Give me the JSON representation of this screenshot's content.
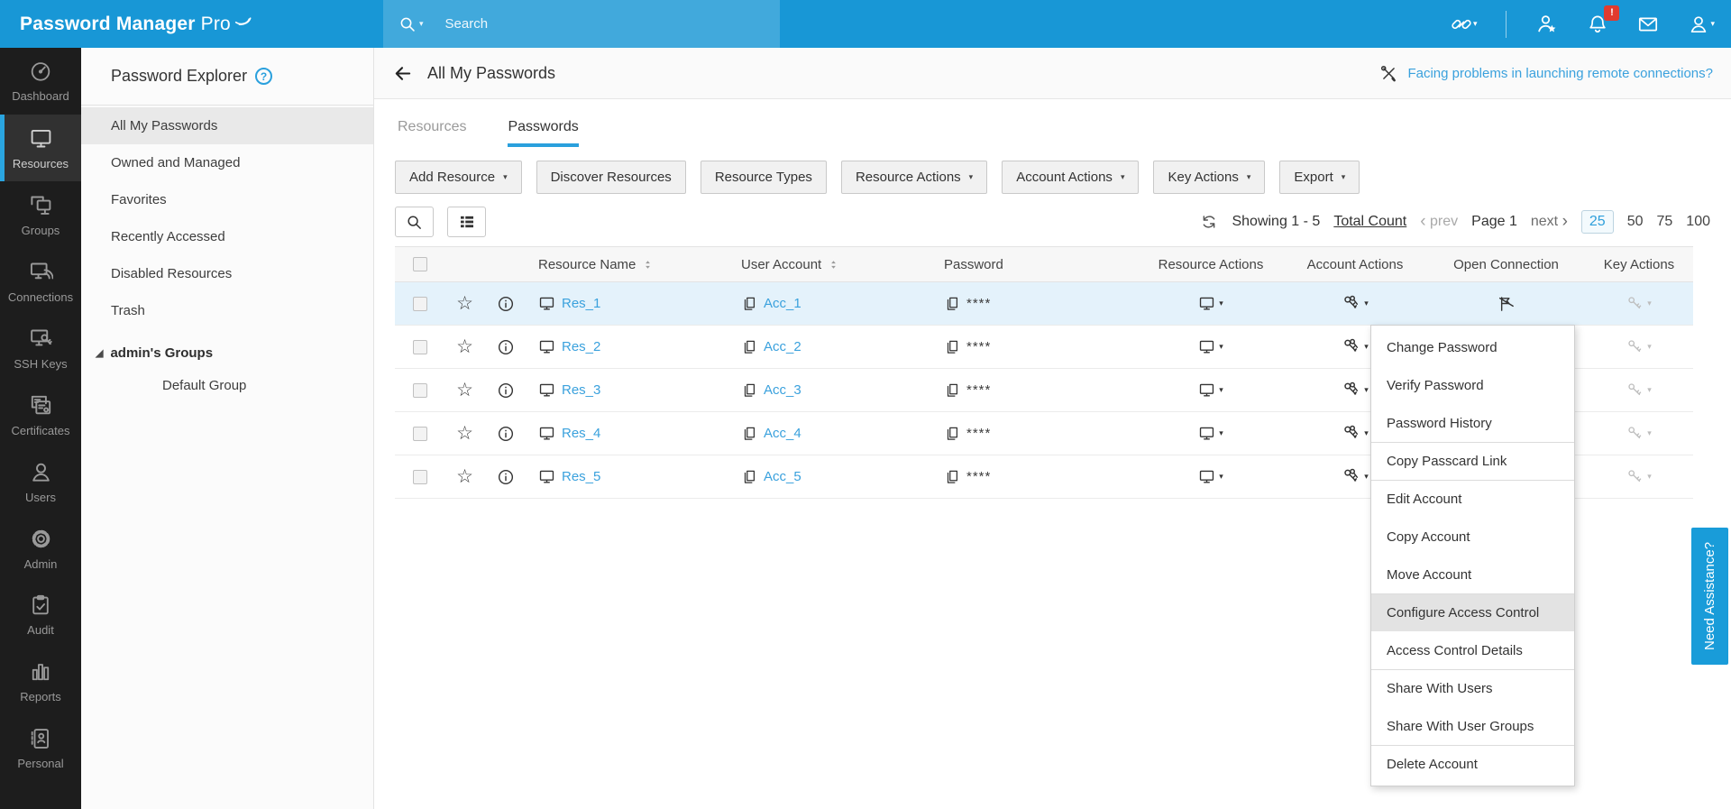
{
  "app": {
    "logo_text": "Password Manager",
    "logo_suffix": "Pro"
  },
  "topbar": {
    "search_placeholder": "Search",
    "notification_badge": "!"
  },
  "icons": {
    "caret_down": "▾",
    "tree_expanded": "◢",
    "star_outline": "☆",
    "prev_chevron": "‹",
    "next_chevron": "›",
    "help_question": "?"
  },
  "sidebar": {
    "items": [
      {
        "label": "Dashboard",
        "active": false
      },
      {
        "label": "Resources",
        "active": true
      },
      {
        "label": "Groups",
        "active": false
      },
      {
        "label": "Connections",
        "active": false
      },
      {
        "label": "SSH Keys",
        "active": false
      },
      {
        "label": "Certificates",
        "active": false
      },
      {
        "label": "Users",
        "active": false
      },
      {
        "label": "Admin",
        "active": false
      },
      {
        "label": "Audit",
        "active": false
      },
      {
        "label": "Reports",
        "active": false
      },
      {
        "label": "Personal",
        "active": false
      }
    ]
  },
  "explorer": {
    "title": "Password Explorer",
    "items": [
      {
        "label": "All My Passwords",
        "active": true
      },
      {
        "label": "Owned and Managed",
        "active": false
      },
      {
        "label": "Favorites",
        "active": false
      },
      {
        "label": "Recently Accessed",
        "active": false
      },
      {
        "label": "Disabled Resources",
        "active": false
      },
      {
        "label": "Trash",
        "active": false
      }
    ],
    "tree": {
      "header": "admin's Groups",
      "children": [
        "Default Group"
      ]
    }
  },
  "main": {
    "page_title": "All My Passwords",
    "help_link": "Facing problems in launching remote connections?",
    "tabs": [
      {
        "label": "Resources",
        "active": false
      },
      {
        "label": "Passwords",
        "active": true
      }
    ],
    "toolbar": [
      {
        "label": "Add Resource",
        "dropdown": true
      },
      {
        "label": "Discover Resources",
        "dropdown": false
      },
      {
        "label": "Resource Types",
        "dropdown": false
      },
      {
        "label": "Resource Actions",
        "dropdown": true
      },
      {
        "label": "Account Actions",
        "dropdown": true
      },
      {
        "label": "Key Actions",
        "dropdown": true
      },
      {
        "label": "Export",
        "dropdown": true
      }
    ],
    "pagination": {
      "showing": "Showing 1 - 5",
      "total_count": "Total Count",
      "prev": "prev",
      "page": "Page 1",
      "next": "next",
      "sizes": [
        "25",
        "50",
        "75",
        "100"
      ],
      "active_size": "25"
    },
    "table": {
      "columns": [
        "Resource Name",
        "User Account",
        "Password",
        "Resource Actions",
        "Account Actions",
        "Open Connection",
        "Key Actions"
      ],
      "rows": [
        {
          "resource": "Res_1",
          "account": "Acc_1",
          "password": "****"
        },
        {
          "resource": "Res_2",
          "account": "Acc_2",
          "password": "****"
        },
        {
          "resource": "Res_3",
          "account": "Acc_3",
          "password": "****"
        },
        {
          "resource": "Res_4",
          "account": "Acc_4",
          "password": "****"
        },
        {
          "resource": "Res_5",
          "account": "Acc_5",
          "password": "****"
        }
      ]
    }
  },
  "context_menu": {
    "items": [
      {
        "label": "Change Password",
        "highlighted": false
      },
      {
        "label": "Verify Password",
        "highlighted": false
      },
      {
        "label": "Password History",
        "highlighted": false
      },
      {
        "label": "Copy Passcard Link",
        "highlighted": false
      },
      {
        "label": "Edit Account",
        "highlighted": false
      },
      {
        "label": "Copy Account",
        "highlighted": false
      },
      {
        "label": "Move Account",
        "highlighted": false
      },
      {
        "label": "Configure Access Control",
        "highlighted": true
      },
      {
        "label": "Access Control Details",
        "highlighted": false
      },
      {
        "label": "Share With Users",
        "highlighted": false
      },
      {
        "label": "Share With User Groups",
        "highlighted": false
      },
      {
        "label": "Delete Account",
        "highlighted": false
      }
    ]
  },
  "assistance": {
    "label": "Need Assistance?"
  },
  "colors": {
    "brand_blue": "#1897d6",
    "link_blue": "#3aa1dd",
    "row_highlight": "#e4f2fb",
    "sidebar_dark": "#1d1d1d",
    "badge_red": "#e23b2e"
  }
}
